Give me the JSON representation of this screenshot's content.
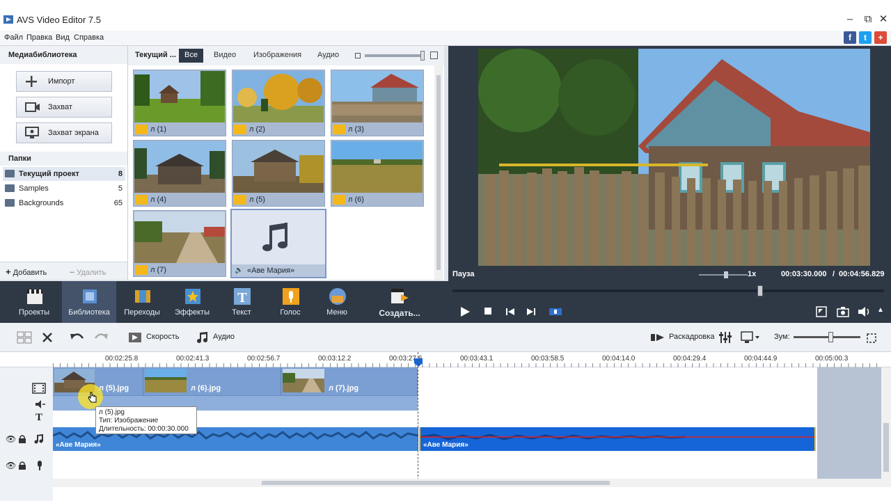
{
  "window": {
    "title": "AVS Video Editor 7.5",
    "minimize": "–",
    "restore": "⧉",
    "close": "✕"
  },
  "menu": [
    "Файл",
    "Правка",
    "Вид",
    "Справка"
  ],
  "social": [
    "f",
    "t",
    "+"
  ],
  "library": {
    "heading": "Медиабиблиотека",
    "buttons": [
      "Импорт",
      "Захват",
      "Захват экрана"
    ],
    "folders_heading": "Папки",
    "folders": [
      {
        "name": "Текущий проект",
        "count": "8"
      },
      {
        "name": "Samples",
        "count": "5"
      },
      {
        "name": "Backgrounds",
        "count": "65"
      }
    ],
    "add_label": "Добавить",
    "remove_label": "Удалить"
  },
  "media_tabs": {
    "current": "Текущий ...",
    "tabs": [
      "Все",
      "Видео",
      "Изображения",
      "Аудио"
    ]
  },
  "media_items": [
    {
      "label": "л (1)"
    },
    {
      "label": "л (2)"
    },
    {
      "label": "л (3)"
    },
    {
      "label": "л (4)"
    },
    {
      "label": "л (5)"
    },
    {
      "label": "л (6)"
    },
    {
      "label": "л (7)"
    },
    {
      "label": "«Аве Мария»"
    }
  ],
  "toolbar": [
    "Проекты",
    "Библиотека",
    "Переходы",
    "Эффекты",
    "Текст",
    "Голос",
    "Меню",
    "Создать..."
  ],
  "preview": {
    "status": "Пауза",
    "speed": "1x",
    "time_current": "00:03:30.000",
    "time_sep": "/",
    "time_total": "00:04:56.829"
  },
  "timeline_toolbar": {
    "speed": "Скорость",
    "audio": "Аудио",
    "storyboard": "Раскадровка",
    "zoom": "Зум:"
  },
  "ruler_ticks": [
    "00:02:25.8",
    "00:02:41.3",
    "00:02:56.7",
    "00:03:12.2",
    "00:03:27.6",
    "00:03:43.1",
    "00:03:58.5",
    "00:04:14.0",
    "00:04:29.4",
    "00:04:44.9",
    "00:05:00.3"
  ],
  "clips": [
    "л (5).jpg",
    "л (6).jpg",
    "л (7).jpg"
  ],
  "audio_clips": [
    "«Аве Мария»",
    "«Аве Мария»"
  ],
  "tooltip": {
    "line1": "л (5).jpg",
    "line2": "Тип: Изображение",
    "line3": "Длительность: 00:00:30.000"
  },
  "colors": {
    "accent_blue": "#1565d8",
    "dark_panel": "#2f3946",
    "clip_blue": "#7b9fd2"
  }
}
